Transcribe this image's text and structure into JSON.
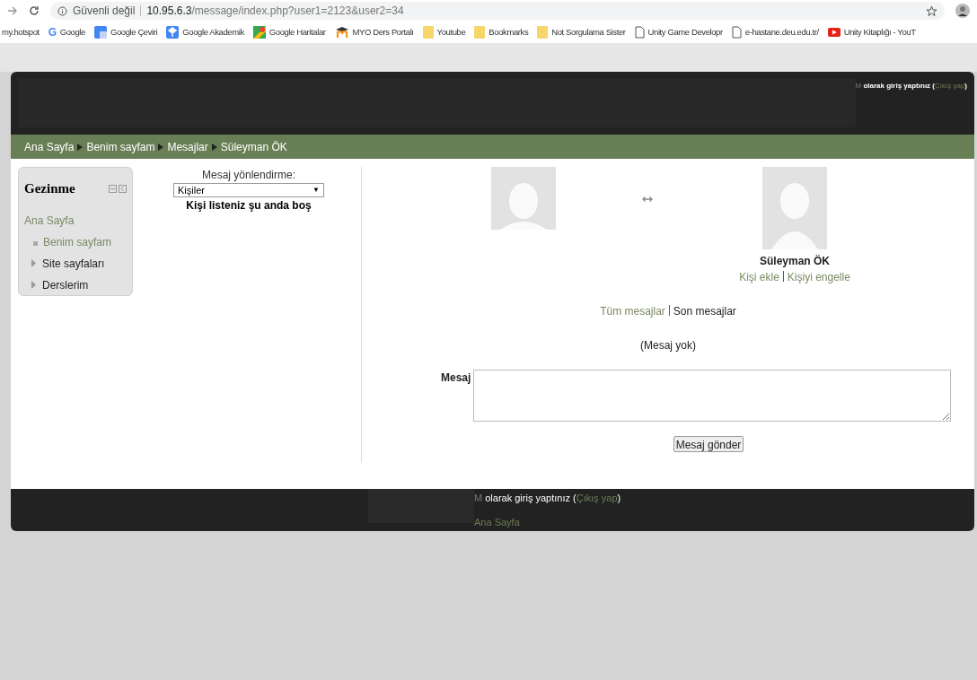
{
  "browser": {
    "security": "Güvenli değil",
    "url_host": "10.95.6.3",
    "url_path": "/message/index.php?user1=2123&user2=34",
    "bookmarks": [
      {
        "kind": "none",
        "label": "my.hotspot"
      },
      {
        "kind": "google",
        "icon_text": "G",
        "label": "Google"
      },
      {
        "kind": "translate",
        "label": "Google Çeviri"
      },
      {
        "kind": "scholar",
        "label": "Google Akademik"
      },
      {
        "kind": "maps",
        "label": "Google Haritalar"
      },
      {
        "kind": "moodle",
        "label": "MYO Ders Portalı"
      },
      {
        "kind": "folder",
        "label": "Youtube"
      },
      {
        "kind": "folder",
        "label": "Bookmarks"
      },
      {
        "kind": "folder",
        "label": "Not Sorgulama Sister"
      },
      {
        "kind": "page",
        "label": "Unity Game Developr"
      },
      {
        "kind": "page",
        "label": "e-hastane.deu.edu.tr/"
      },
      {
        "kind": "youtube",
        "label": "Unity Kitaplığı - YouT"
      }
    ]
  },
  "header": {
    "user_initial": "M",
    "login_text": "olarak giriş yaptınız (",
    "logout": "Çıkış yap",
    "close": ")"
  },
  "breadcrumb": [
    "Ana Sayfa",
    "Benim sayfam",
    "Mesajlar",
    "Süleyman ÖK"
  ],
  "navigation": {
    "title": "Gezinme",
    "items": [
      {
        "label": "Ana Sayfa",
        "kind": "link",
        "children": [
          {
            "label": "Benim sayfam",
            "kind": "leaf"
          },
          {
            "label": "Site sayfaları",
            "kind": "branch",
            "expanded": false
          },
          {
            "label": "Derslerim",
            "kind": "branch",
            "expanded": false
          }
        ]
      }
    ]
  },
  "contacts": {
    "label": "Mesaj yönlendirme:",
    "select_value": "Kişiler",
    "select_arrow": "▼",
    "empty": "Kişi listeniz şu anda boş"
  },
  "conversation": {
    "other_user": "Süleyman ÖK",
    "actions": [
      "Kişi ekle",
      "Kişiyi engelle"
    ],
    "history_links": [
      {
        "label": "Tüm mesajlar",
        "selected": false
      },
      {
        "label": "Son mesajlar",
        "selected": true
      }
    ],
    "empty": "(Mesaj yok)",
    "message_label": "Mesaj",
    "send": "Mesaj gönder"
  },
  "footer": {
    "user_initial": "M",
    "login_text": "olarak giriş yaptınız (",
    "logout": "Çıkış yap",
    "close": ")",
    "home": "Ana Sayfa"
  }
}
